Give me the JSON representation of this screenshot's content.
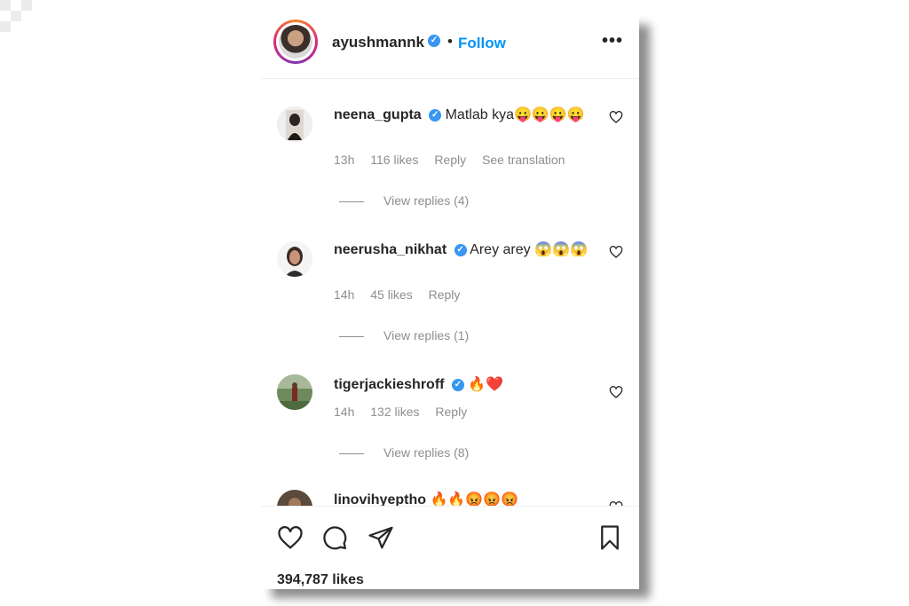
{
  "post": {
    "username": "ayushmannk",
    "dot": "•",
    "follow_label": "Follow",
    "more_label": "•••"
  },
  "comments": [
    {
      "user": "neena_gupta",
      "text": "Matlab kya",
      "emoji": "😛😛😛😛",
      "time": "13h",
      "likes": "116 likes",
      "reply": "Reply",
      "translation": "See translation",
      "view_replies": "View replies (4)"
    },
    {
      "user": "neerusha_nikhat",
      "text": "Arey arey",
      "emoji": "😱😱😱",
      "time": "14h",
      "likes": "45 likes",
      "reply": "Reply",
      "view_replies": "View replies (1)"
    },
    {
      "user": "tigerjackieshroff",
      "text": "",
      "emoji": "🔥❤️",
      "time": "14h",
      "likes": "132 likes",
      "reply": "Reply",
      "view_replies": "View replies (8)"
    },
    {
      "user": "linovihyeptho",
      "text": "",
      "emoji": "🔥🔥😡😡😡"
    }
  ],
  "footer": {
    "likes_total": "394,787 likes"
  },
  "icons": {
    "like": "heart-icon",
    "comment": "comment-icon",
    "share": "send-icon",
    "save": "bookmark-icon"
  },
  "colors": {
    "follow": "#0095f6",
    "verified": "#3897f0",
    "muted": "#8e8e8e",
    "text": "#262626"
  }
}
